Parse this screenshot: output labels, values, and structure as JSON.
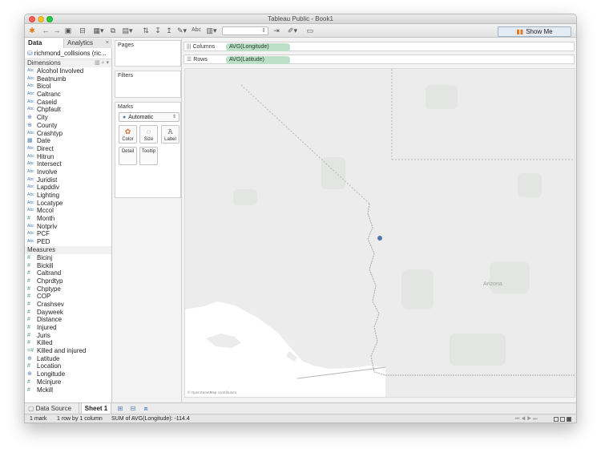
{
  "window": {
    "title": "Tableau Public - Book1"
  },
  "toolbar": {
    "abc_label": "Abc",
    "show_me_label": "Show Me"
  },
  "left_panel": {
    "tabs": {
      "data": "Data",
      "analytics": "Analytics"
    },
    "datasource": "richmond_collisions (ric...",
    "dimensions_header": "Dimensions",
    "dimensions": [
      {
        "name": "Alcohol Involved",
        "type": "Abc"
      },
      {
        "name": "Beatnumb",
        "type": "Abc"
      },
      {
        "name": "Bicol",
        "type": "Abc"
      },
      {
        "name": "Caltranc",
        "type": "Abc"
      },
      {
        "name": "Caseid",
        "type": "Abc"
      },
      {
        "name": "Chpfault",
        "type": "Abc"
      },
      {
        "name": "City",
        "type": "geo"
      },
      {
        "name": "County",
        "type": "geo"
      },
      {
        "name": "Crashtyp",
        "type": "Abc"
      },
      {
        "name": "Date",
        "type": "date"
      },
      {
        "name": "Direct",
        "type": "Abc"
      },
      {
        "name": "Hitrun",
        "type": "Abc"
      },
      {
        "name": "Intersect",
        "type": "Abc"
      },
      {
        "name": "Involve",
        "type": "Abc"
      },
      {
        "name": "Juridist",
        "type": "Abc"
      },
      {
        "name": "Lapddiv",
        "type": "Abc"
      },
      {
        "name": "Lighting",
        "type": "Abc"
      },
      {
        "name": "Locatype",
        "type": "Abc"
      },
      {
        "name": "Mccol",
        "type": "Abc"
      },
      {
        "name": "Month",
        "type": "num"
      },
      {
        "name": "Notpriv",
        "type": "Abc"
      },
      {
        "name": "PCF",
        "type": "Abc"
      },
      {
        "name": "PED",
        "type": "Abc"
      }
    ],
    "measures_header": "Measures",
    "measures": [
      {
        "name": "Bicinj",
        "type": "num"
      },
      {
        "name": "Bickill",
        "type": "num"
      },
      {
        "name": "Caltrand",
        "type": "num"
      },
      {
        "name": "Chprdtyp",
        "type": "num"
      },
      {
        "name": "Chptype",
        "type": "num"
      },
      {
        "name": "COP",
        "type": "num"
      },
      {
        "name": "Crashsev",
        "type": "num"
      },
      {
        "name": "Dayweek",
        "type": "num"
      },
      {
        "name": "Distance",
        "type": "num"
      },
      {
        "name": "Injured",
        "type": "num"
      },
      {
        "name": "Juris",
        "type": "num"
      },
      {
        "name": "Killed",
        "type": "num"
      },
      {
        "name": "Killed and injured",
        "type": "calc"
      },
      {
        "name": "Latitude",
        "type": "geo"
      },
      {
        "name": "Location",
        "type": "num"
      },
      {
        "name": "Longitude",
        "type": "geo"
      },
      {
        "name": "Mcinjure",
        "type": "num"
      },
      {
        "name": "Mckill",
        "type": "num"
      }
    ]
  },
  "cards": {
    "pages": "Pages",
    "filters": "Filters",
    "marks": "Marks",
    "mark_type": "Automatic",
    "buttons": {
      "color": "Color",
      "size": "Size",
      "label": "Label",
      "detail": "Detail",
      "tooltip": "Tooltip"
    }
  },
  "shelves": {
    "columns_label": "Columns",
    "columns_pill": "AVG(Longitude)",
    "rows_label": "Rows",
    "rows_pill": "AVG(Latitude)"
  },
  "map": {
    "region_label": "Arizona",
    "attribution": "© OpenStreetMap contributors",
    "water_color": "#ffffff",
    "land_color": "#ececec",
    "mark_color": "#4e79a7"
  },
  "bottom_tabs": {
    "data_source": "Data Source",
    "sheet": "Sheet 1"
  },
  "status": {
    "marks": "1 mark",
    "dims": "1 row by 1 column",
    "sum": "SUM of AVG(Longitude): -114.4"
  }
}
